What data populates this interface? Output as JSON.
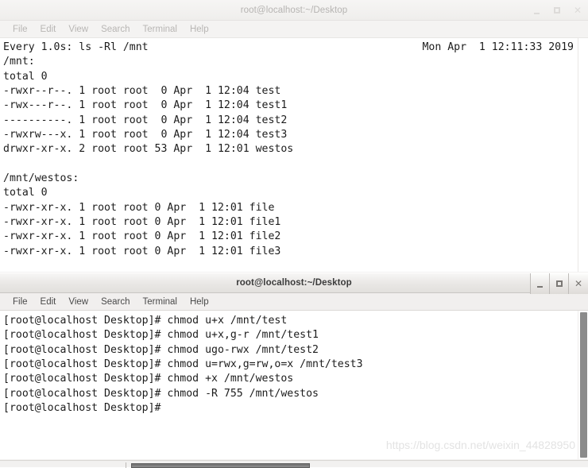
{
  "windows": [
    {
      "title": "root@localhost:~/Desktop",
      "active": false,
      "menu": [
        "File",
        "Edit",
        "View",
        "Search",
        "Terminal",
        "Help"
      ],
      "controls": {
        "minimize": "–",
        "maximize": "□",
        "close": "✕"
      },
      "watch": {
        "command": "Every 1.0s: ls -Rl /mnt",
        "datetime": "Mon Apr  1 12:11:33 2019"
      },
      "content": "\n/mnt:\ntotal 0\n-rwxr--r--. 1 root root  0 Apr  1 12:04 test\n-rwx---r--. 1 root root  0 Apr  1 12:04 test1\n----------. 1 root root  0 Apr  1 12:04 test2\n-rwxrw---x. 1 root root  0 Apr  1 12:04 test3\ndrwxr-xr-x. 2 root root 53 Apr  1 12:01 westos\n\n/mnt/westos:\ntotal 0\n-rwxr-xr-x. 1 root root 0 Apr  1 12:01 file\n-rwxr-xr-x. 1 root root 0 Apr  1 12:01 file1\n-rwxr-xr-x. 1 root root 0 Apr  1 12:01 file2\n-rwxr-xr-x. 1 root root 0 Apr  1 12:01 file3"
    },
    {
      "title": "root@localhost:~/Desktop",
      "active": true,
      "menu": [
        "File",
        "Edit",
        "View",
        "Search",
        "Terminal",
        "Help"
      ],
      "controls": {
        "minimize": "–",
        "maximize": "□",
        "close": "✕"
      },
      "content": "[root@localhost Desktop]# chmod u+x /mnt/test\n[root@localhost Desktop]# chmod u+x,g-r /mnt/test1\n[root@localhost Desktop]# chmod ugo-rwx /mnt/test2\n[root@localhost Desktop]# chmod u=rwx,g=rw,o=x /mnt/test3\n[root@localhost Desktop]# chmod +x /mnt/westos\n[root@localhost Desktop]# chmod -R 755 /mnt/westos\n[root@localhost Desktop]#"
    }
  ],
  "watermark": "https://blog.csdn.net/weixin_44828950",
  "colors": {
    "terminal_bg": "#ffffff",
    "terminal_fg": "#1c1c1c",
    "chrome_bg": "#f2f1f0",
    "title_active": "#3b3b3b",
    "title_inactive": "#b6b4b2"
  }
}
